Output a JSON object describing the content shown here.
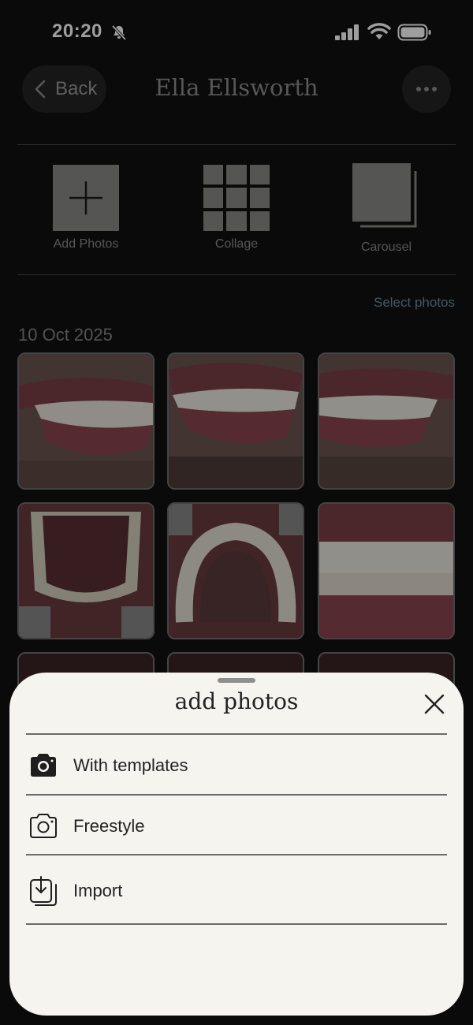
{
  "status_bar": {
    "time": "20:20"
  },
  "header": {
    "back_label": "Back",
    "title": "Ella Ellsworth"
  },
  "actions": [
    {
      "label": "Add Photos",
      "icon": "plus-square-icon"
    },
    {
      "label": "Collage",
      "icon": "grid-icon"
    },
    {
      "label": "Carousel",
      "icon": "stacked-squares-icon"
    }
  ],
  "select_photos_label": "Select photos",
  "date_group": "10 Oct 2025",
  "accent_color": "#6d8ea0",
  "sheet": {
    "title": "add photos",
    "items": [
      {
        "label": "With templates",
        "icon": "camera-filled-icon"
      },
      {
        "label": "Freestyle",
        "icon": "camera-outline-icon"
      },
      {
        "label": "Import",
        "icon": "import-icon"
      }
    ]
  }
}
